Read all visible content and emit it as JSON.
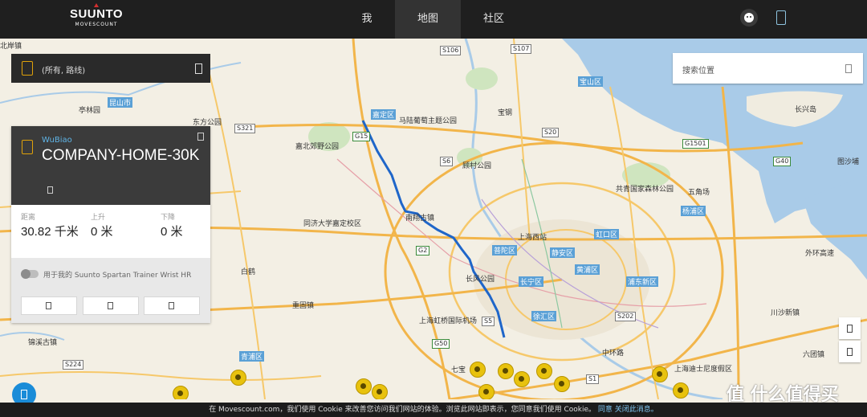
{
  "brand": {
    "name": "SUUNTO",
    "sub": "MOVESCOUNT"
  },
  "nav": [
    {
      "label": "我"
    },
    {
      "label": "地图"
    },
    {
      "label": "社区"
    }
  ],
  "filter": {
    "text": "(所有, 路线)"
  },
  "search": {
    "placeholder": "搜索位置"
  },
  "route_card": {
    "user": "WuBiao",
    "title": "COMPANY-HOME-30K",
    "stats": [
      {
        "label": "距离",
        "value": "30.82",
        "unit": "千米"
      },
      {
        "label": "上升",
        "value": "0",
        "unit": "米"
      },
      {
        "label": "下降",
        "value": "0",
        "unit": "米"
      }
    ],
    "device_text": "用于我的 Suunto Spartan Trainer Wrist HR"
  },
  "map_labels": [
    "嘉定区",
    "马陆葡萄主题公园",
    "嘉北郊野公园",
    "顾村公园",
    "宝山区",
    "长兴岛",
    "南翔古镇",
    "同济大学嘉定校区",
    "上海西站",
    "普陀区",
    "静安区",
    "虹口区",
    "共青国家森林公园",
    "五角场",
    "杨浦区",
    "黄浦区",
    "长宁区",
    "长风公园",
    "徐汇区",
    "上海虹桥国际机场",
    "青浦区",
    "七宝",
    "上海迪士尼度假区",
    "昆山市",
    "亭林园",
    "重固镇",
    "浦东新区",
    "锦溪古镇",
    "白鹤",
    "六团镇",
    "川沙新镇",
    "东方公园",
    "图沙埔",
    "北岸镇",
    "宝钢",
    "外环高速",
    "中环路"
  ],
  "road_shields": [
    "G15",
    "S6",
    "S20",
    "G1501",
    "G2",
    "G50",
    "S224",
    "S5",
    "S321",
    "S106",
    "S107",
    "G40",
    "S202",
    "S1"
  ],
  "cookie": {
    "text": "在 Movescount.com，我们使用 Cookie 来改善您访问我们网站的体验。浏览此网站即表示，您同意我们使用 Cookie。",
    "agree": "同意",
    "close": "关闭此消息。"
  },
  "watermark": "值 什么值得买",
  "colors": {
    "topbar": "#1f1f1f",
    "accent_blue": "#5fb4e6",
    "route": "#1f66c9",
    "icon_gold": "#e0a20a"
  }
}
